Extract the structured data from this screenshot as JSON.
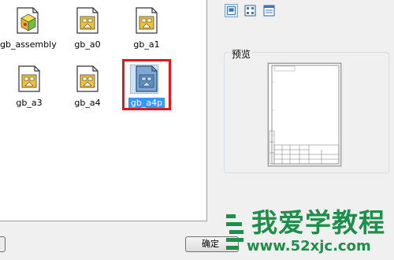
{
  "files": [
    {
      "name": "gb_assembly",
      "icon": "assembly-template-icon",
      "selected": false
    },
    {
      "name": "gb_a0",
      "icon": "drawing-template-icon",
      "selected": false
    },
    {
      "name": "gb_a1",
      "icon": "drawing-template-icon",
      "selected": false
    },
    {
      "name": "gb_a3",
      "icon": "drawing-template-icon",
      "selected": false
    },
    {
      "name": "gb_a4",
      "icon": "drawing-template-icon",
      "selected": false
    },
    {
      "name": "gb_a4p",
      "icon": "drawing-template-icon",
      "selected": true
    }
  ],
  "preview": {
    "title": "预览"
  },
  "buttons": {
    "ok_label": "确定"
  },
  "watermark": {
    "text": "我爱学教程",
    "url": "www.52xjc.com"
  },
  "colors": {
    "selection": "#3399ff",
    "highlight_frame": "#e01818",
    "watermark": "#1d8f4a"
  }
}
